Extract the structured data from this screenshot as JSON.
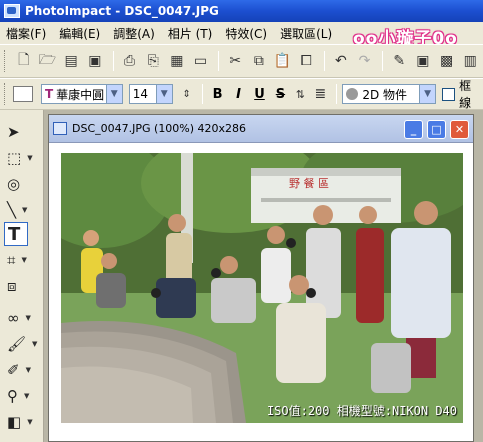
{
  "app": {
    "title": "PhotoImpact - DSC_0047.JPG"
  },
  "watermark": "oo小璇子0o",
  "menu": [
    "檔案(F)",
    "編輯(E)",
    "調整(A)",
    "相片 (T)",
    "特效(C)",
    "選取區(L)"
  ],
  "toolbar_text": {
    "font_name": "華康中圓",
    "font_size": "14",
    "bold": "B",
    "italic": "I",
    "underline": "U",
    "strike": "S",
    "mode": "2D 物件",
    "checkbox_label": "框線"
  },
  "document": {
    "title": "DSC_0047.JPG (100%) 420x286",
    "caption": "ISO值:200 相機型號:NIKON D40"
  },
  "photo_sign": "野 餐 區",
  "colors": {
    "title_bar": "#1c4fd0",
    "menu_bg": "#ece9d8",
    "watermark": "#e0308a"
  }
}
